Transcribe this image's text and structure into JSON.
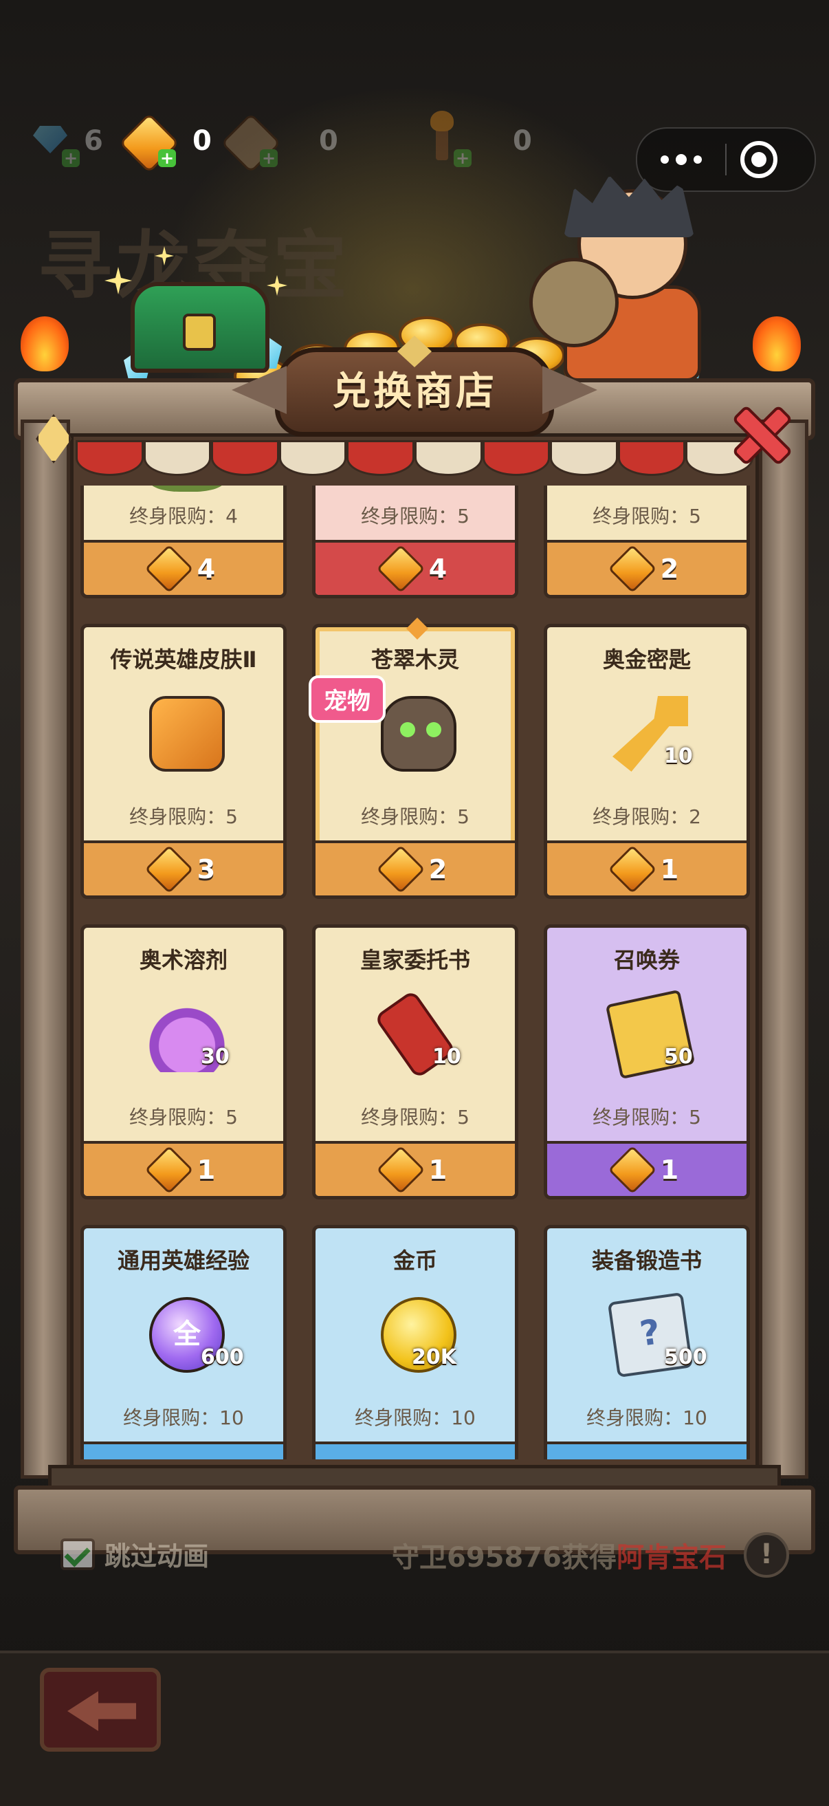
{
  "currencies": [
    {
      "name": "diamond",
      "value": "6"
    },
    {
      "name": "gold-gem",
      "value": "0"
    },
    {
      "name": "chest-key",
      "value": "0"
    },
    {
      "name": "torch",
      "value": "0"
    }
  ],
  "background_title": "寻龙夺宝",
  "shop_title": "兑换商店",
  "items": [
    {
      "name": "",
      "limit": "终身限购：4",
      "price": "4",
      "style": "normal",
      "icon": "leaf-icon",
      "qty": ""
    },
    {
      "name": "",
      "limit": "终身限购：5",
      "price": "4",
      "style": "pink",
      "icon": "item-icon",
      "qty": ""
    },
    {
      "name": "",
      "limit": "终身限购：5",
      "price": "2",
      "style": "normal",
      "icon": "item-icon",
      "qty": ""
    },
    {
      "name": "传说英雄皮肤Ⅱ",
      "limit": "终身限购：5",
      "price": "3",
      "style": "normal",
      "icon": "hero-skin-chest-icon",
      "qty": ""
    },
    {
      "name": "苍翠木灵",
      "limit": "终身限购：5",
      "price": "2",
      "style": "highlight",
      "icon": "tree-spirit-icon",
      "qty": "",
      "tag": "宠物"
    },
    {
      "name": "奥金密匙",
      "limit": "终身限购：2",
      "price": "1",
      "style": "normal",
      "icon": "golden-key-icon",
      "qty": "10"
    },
    {
      "name": "奥术溶剂",
      "limit": "终身限购：5",
      "price": "1",
      "style": "normal",
      "icon": "potion-icon",
      "qty": "30"
    },
    {
      "name": "皇家委托书",
      "limit": "终身限购：5",
      "price": "1",
      "style": "normal",
      "icon": "scroll-icon",
      "qty": "10"
    },
    {
      "name": "召唤券",
      "limit": "终身限购：5",
      "price": "1",
      "style": "purple",
      "icon": "summon-ticket-icon",
      "qty": "50"
    },
    {
      "name": "通用英雄经验",
      "limit": "终身限购：10",
      "price": "",
      "style": "blue",
      "icon": "exp-orb-icon",
      "qty": "600",
      "icon_text": "全"
    },
    {
      "name": "金币",
      "limit": "终身限购：10",
      "price": "",
      "style": "blue",
      "icon": "gold-coin-icon",
      "qty": "20K"
    },
    {
      "name": "装备锻造书",
      "limit": "终身限购：10",
      "price": "",
      "style": "blue",
      "icon": "forge-book-icon",
      "qty": "500",
      "icon_text": "?"
    }
  ],
  "footer": {
    "skip_label": "跳过动画",
    "ticker_prefix": "守卫695876获得",
    "ticker_item": "阿肯宝石",
    "info_label": "!"
  },
  "colors": {
    "card_normal": "#f4e6bf",
    "card_purple": "#d6bff0",
    "card_blue": "#bfe2f4",
    "accent_gold": "#f39a1c"
  }
}
